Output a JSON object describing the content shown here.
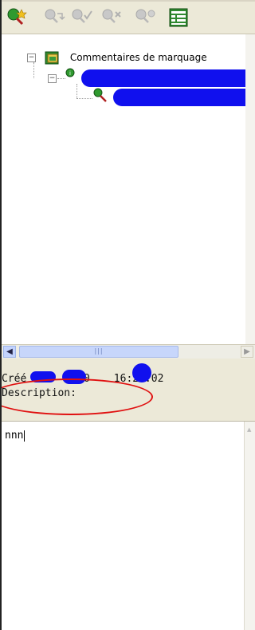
{
  "toolbar": {
    "buttons": [
      {
        "name": "add-comment",
        "icon": "comment-add-icon",
        "enabled": true
      },
      {
        "name": "reply-comment",
        "icon": "comment-reply-icon",
        "enabled": false
      },
      {
        "name": "accept-comment",
        "icon": "comment-accept-icon",
        "enabled": false
      },
      {
        "name": "delete-comment",
        "icon": "comment-delete-icon",
        "enabled": false
      },
      {
        "name": "comment-options",
        "icon": "comment-options-icon",
        "enabled": false
      },
      {
        "name": "table-view",
        "icon": "spreadsheet-icon",
        "enabled": true
      }
    ]
  },
  "tree": {
    "root_label": "Commentaires de marquage"
  },
  "info": {
    "created_prefix": "Créé",
    "created_date_partial": "/20",
    "created_time": "16:26:02",
    "description_label": "Description:"
  },
  "editor": {
    "text": "nnn"
  },
  "colors": {
    "redaction": "#1010ee",
    "annotation_circle": "#e01010",
    "panel_bg": "#ece9d8"
  }
}
